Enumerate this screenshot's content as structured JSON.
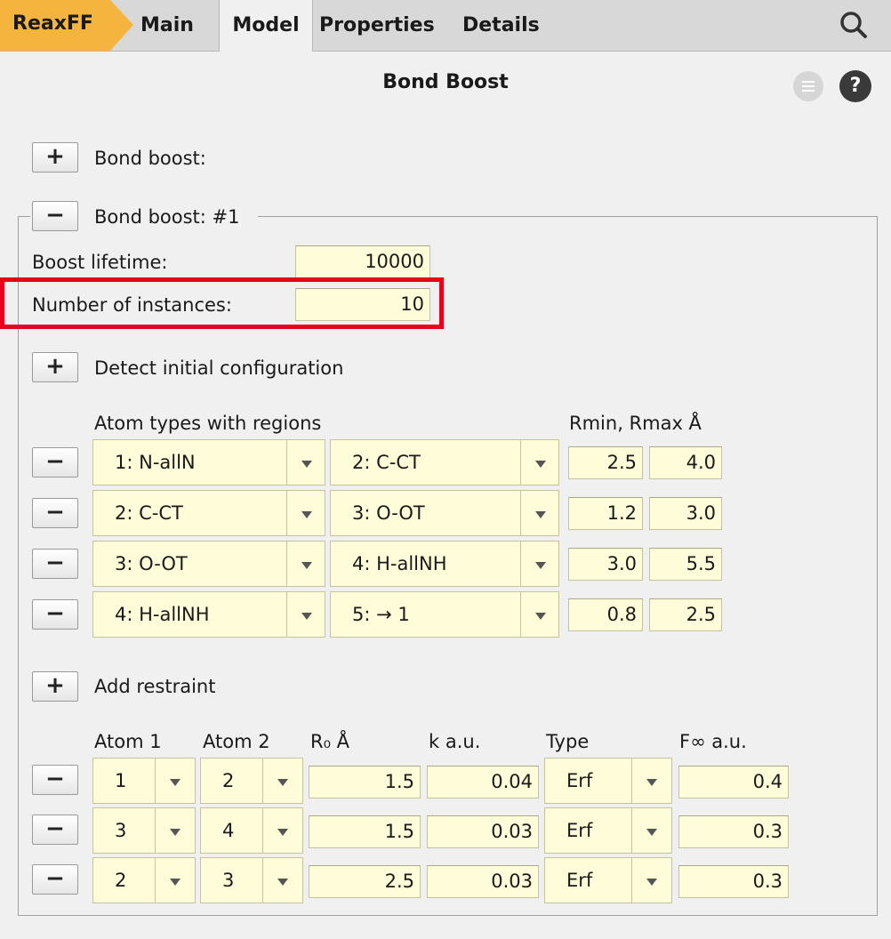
{
  "breadcrumb": {
    "root": "ReaxFF"
  },
  "tabs": [
    {
      "label": "Main"
    },
    {
      "label": "Model"
    },
    {
      "label": "Properties"
    },
    {
      "label": "Details"
    }
  ],
  "panel": {
    "title": "Bond Boost",
    "help": "?"
  },
  "bond_boost_add": {
    "button": "+",
    "label": "Bond boost:"
  },
  "bond_boost_1": {
    "button": "−",
    "label": "Bond boost: #1",
    "boost_lifetime": {
      "label": "Boost lifetime:",
      "value": "10000"
    },
    "num_instances": {
      "label": "Number of instances:",
      "value": "10"
    }
  },
  "detect": {
    "button": "+",
    "label": "Detect initial configuration"
  },
  "atom_types": {
    "header": "Atom types with regions",
    "range_header": "Rmin, Rmax Å",
    "rows": [
      {
        "remove": "−",
        "type1": "1: N-allN",
        "type2": "2: C-CT",
        "rmin": "2.5",
        "rmax": "4.0"
      },
      {
        "remove": "−",
        "type1": "2: C-CT",
        "type2": "3: O-OT",
        "rmin": "1.2",
        "rmax": "3.0"
      },
      {
        "remove": "−",
        "type1": "3: O-OT",
        "type2": "4: H-allNH",
        "rmin": "3.0",
        "rmax": "5.5"
      },
      {
        "remove": "−",
        "type1": "4: H-allNH",
        "type2": "5: → 1",
        "rmin": "0.8",
        "rmax": "2.5"
      }
    ]
  },
  "restraint_add": {
    "button": "+",
    "label": "Add restraint"
  },
  "restraints": {
    "headers": {
      "atom1": "Atom 1",
      "atom2": "Atom 2",
      "r0": "R₀ Å",
      "k": "k a.u.",
      "type": "Type",
      "finf": "F∞ a.u."
    },
    "rows": [
      {
        "remove": "−",
        "atom1": "1",
        "atom2": "2",
        "r0": "1.5",
        "k": "0.04",
        "type": "Erf",
        "finf": "0.4"
      },
      {
        "remove": "−",
        "atom1": "3",
        "atom2": "4",
        "r0": "1.5",
        "k": "0.03",
        "type": "Erf",
        "finf": "0.3"
      },
      {
        "remove": "−",
        "atom1": "2",
        "atom2": "3",
        "r0": "2.5",
        "k": "0.03",
        "type": "Erf",
        "finf": "0.3"
      }
    ]
  },
  "icons": {
    "search": "search-icon",
    "menu": "menu-icon",
    "help": "help-icon",
    "dropdown": "chevron-down-icon"
  },
  "colors": {
    "breadcrumb": "#f5b43d",
    "field_bg": "#fffcd9",
    "highlight": "#e8001d",
    "help_icon": "#3a3a3a"
  }
}
